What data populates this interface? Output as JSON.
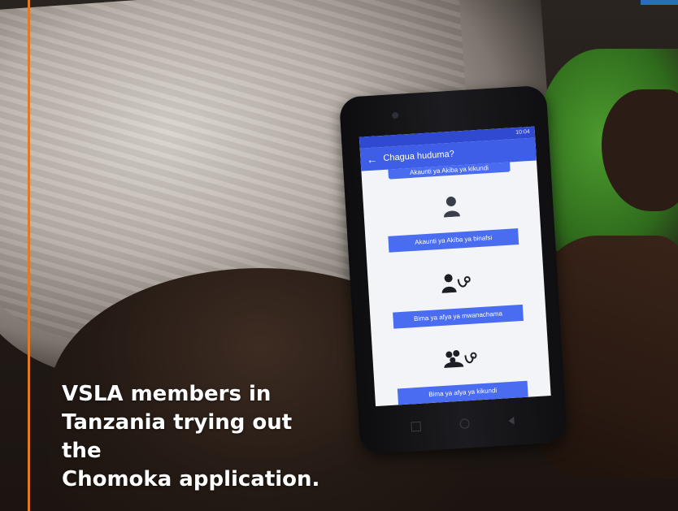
{
  "caption": {
    "lines": [
      "VSLA members in",
      "Tanzania trying out the",
      "Chomoka application."
    ]
  },
  "phone": {
    "status_text": "10:04",
    "app_title": "Chagua huduma?",
    "back_icon": "arrow-left-icon",
    "options": [
      {
        "label": "Akaunti ya Akiba ya kikundi",
        "icon": ""
      },
      {
        "label": "Akaunti ya Akiba ya binafsi",
        "icon": "person-icon"
      },
      {
        "label": "Bima ya afya ya mwanachama",
        "icon": "person-stethoscope-icon"
      },
      {
        "label": "Bima ya afya ya kikundi",
        "icon": "group-stethoscope-icon"
      }
    ]
  },
  "colors": {
    "accent_rule": "#e07b24",
    "app_primary": "#3f5ee8",
    "button": "#4a6cf0"
  }
}
